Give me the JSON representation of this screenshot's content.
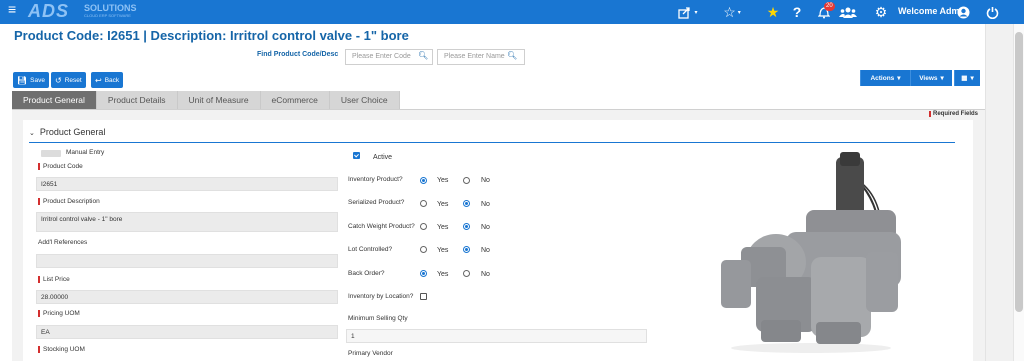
{
  "topbar": {
    "logo_text": "ADS",
    "logo_sub": "SOLUTIONS",
    "logo_tagline": "CLOUD ERP SOFTWARE",
    "notification_count": "20",
    "welcome": "Welcome Admin",
    "icons": [
      "menu-icon",
      "share-icon",
      "star-outline-icon",
      "star-icon",
      "help-icon",
      "bell-icon",
      "users-icon",
      "gear-icon",
      "user-circle-icon",
      "power-icon"
    ]
  },
  "page": {
    "title": "Product Code:  I2651 | Description: Irritrol control valve - 1\" bore",
    "find_label": "Find Product Code/Desc",
    "code_placeholder": "Please Enter Code",
    "name_placeholder": "Please Enter Name"
  },
  "toolbar": {
    "save": "Save",
    "reset": "Reset",
    "back": "Back",
    "actions": "Actions",
    "views": "Views"
  },
  "tabs": [
    "Product General",
    "Product Details",
    "Unit of Measure",
    "eCommerce",
    "User Choice"
  ],
  "required_fields": "Required Fields",
  "section": {
    "title": "Product General"
  },
  "left": {
    "manual_entry": "Manual Entry",
    "product_code_label": "Product Code",
    "product_code": "I2651",
    "product_desc_label": "Product Description",
    "product_desc": "Irritrol control valve - 1\" bore",
    "addl_refs_label": "Add'l References",
    "addl_refs": "",
    "list_price_label": "List Price",
    "list_price": "28.00000",
    "pricing_uom_label": "Pricing UOM",
    "pricing_uom": "EA",
    "stocking_uom_label": "Stocking UOM"
  },
  "middle": {
    "active": "Active",
    "yes": "Yes",
    "no": "No",
    "inventory_product": "Inventory Product?",
    "serialized_product": "Serialized Product?",
    "catch_weight": "Catch Weight Product?",
    "lot_controlled": "Lot Controlled?",
    "back_order": "Back Order?",
    "inventory_by_location": "Inventory by Location?",
    "min_selling_qty_label": "Minimum Selling Qty",
    "min_selling_qty": "1",
    "primary_vendor": "Primary Vendor"
  },
  "colors": {
    "brand": "#1976d2",
    "required": "#d32f2f"
  }
}
